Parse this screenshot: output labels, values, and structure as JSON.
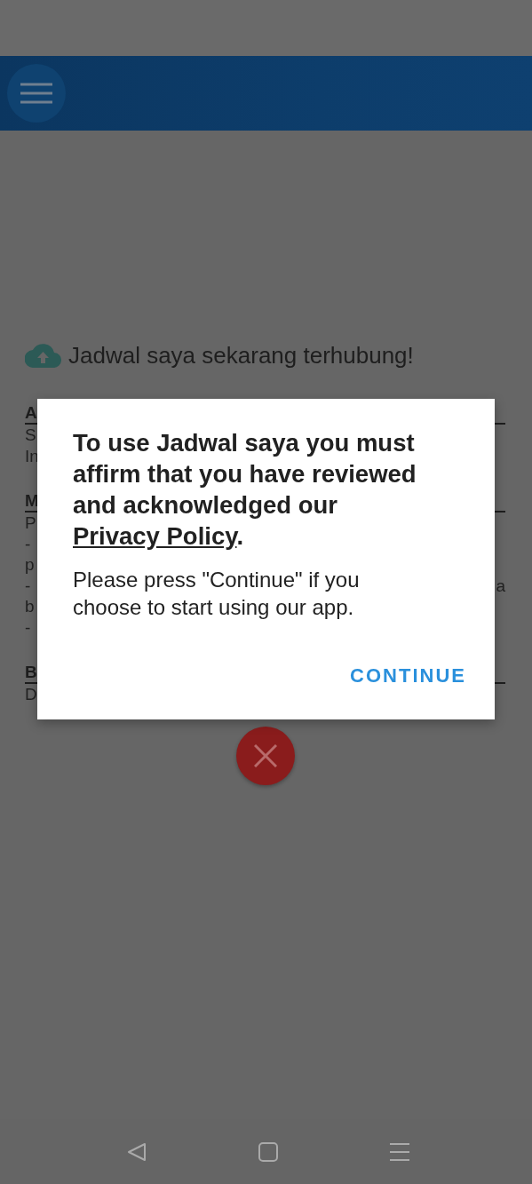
{
  "banner": {
    "text": "Jadwal saya sekarang terhubung!"
  },
  "sections": [
    {
      "heading": "A",
      "lines": [
        {
          "text": "S"
        },
        {
          "text": "In"
        }
      ]
    },
    {
      "heading": "M",
      "lines": [
        {
          "text": "P"
        },
        {
          "text": "-"
        },
        {
          "text": "p"
        },
        {
          "text": "-",
          "trailing": "a"
        },
        {
          "text": "b"
        },
        {
          "text": "-"
        }
      ]
    },
    {
      "heading": "B",
      "lines": [
        {
          "text": "D"
        }
      ]
    }
  ],
  "dialog": {
    "title": "To use Jadwal saya you must affirm that you have reviewed and acknowledged our",
    "link": "Privacy Policy",
    "title_end": ".",
    "message": "Please press \"Continue\" if you choose to start using our app.",
    "button": "CONTINUE"
  }
}
